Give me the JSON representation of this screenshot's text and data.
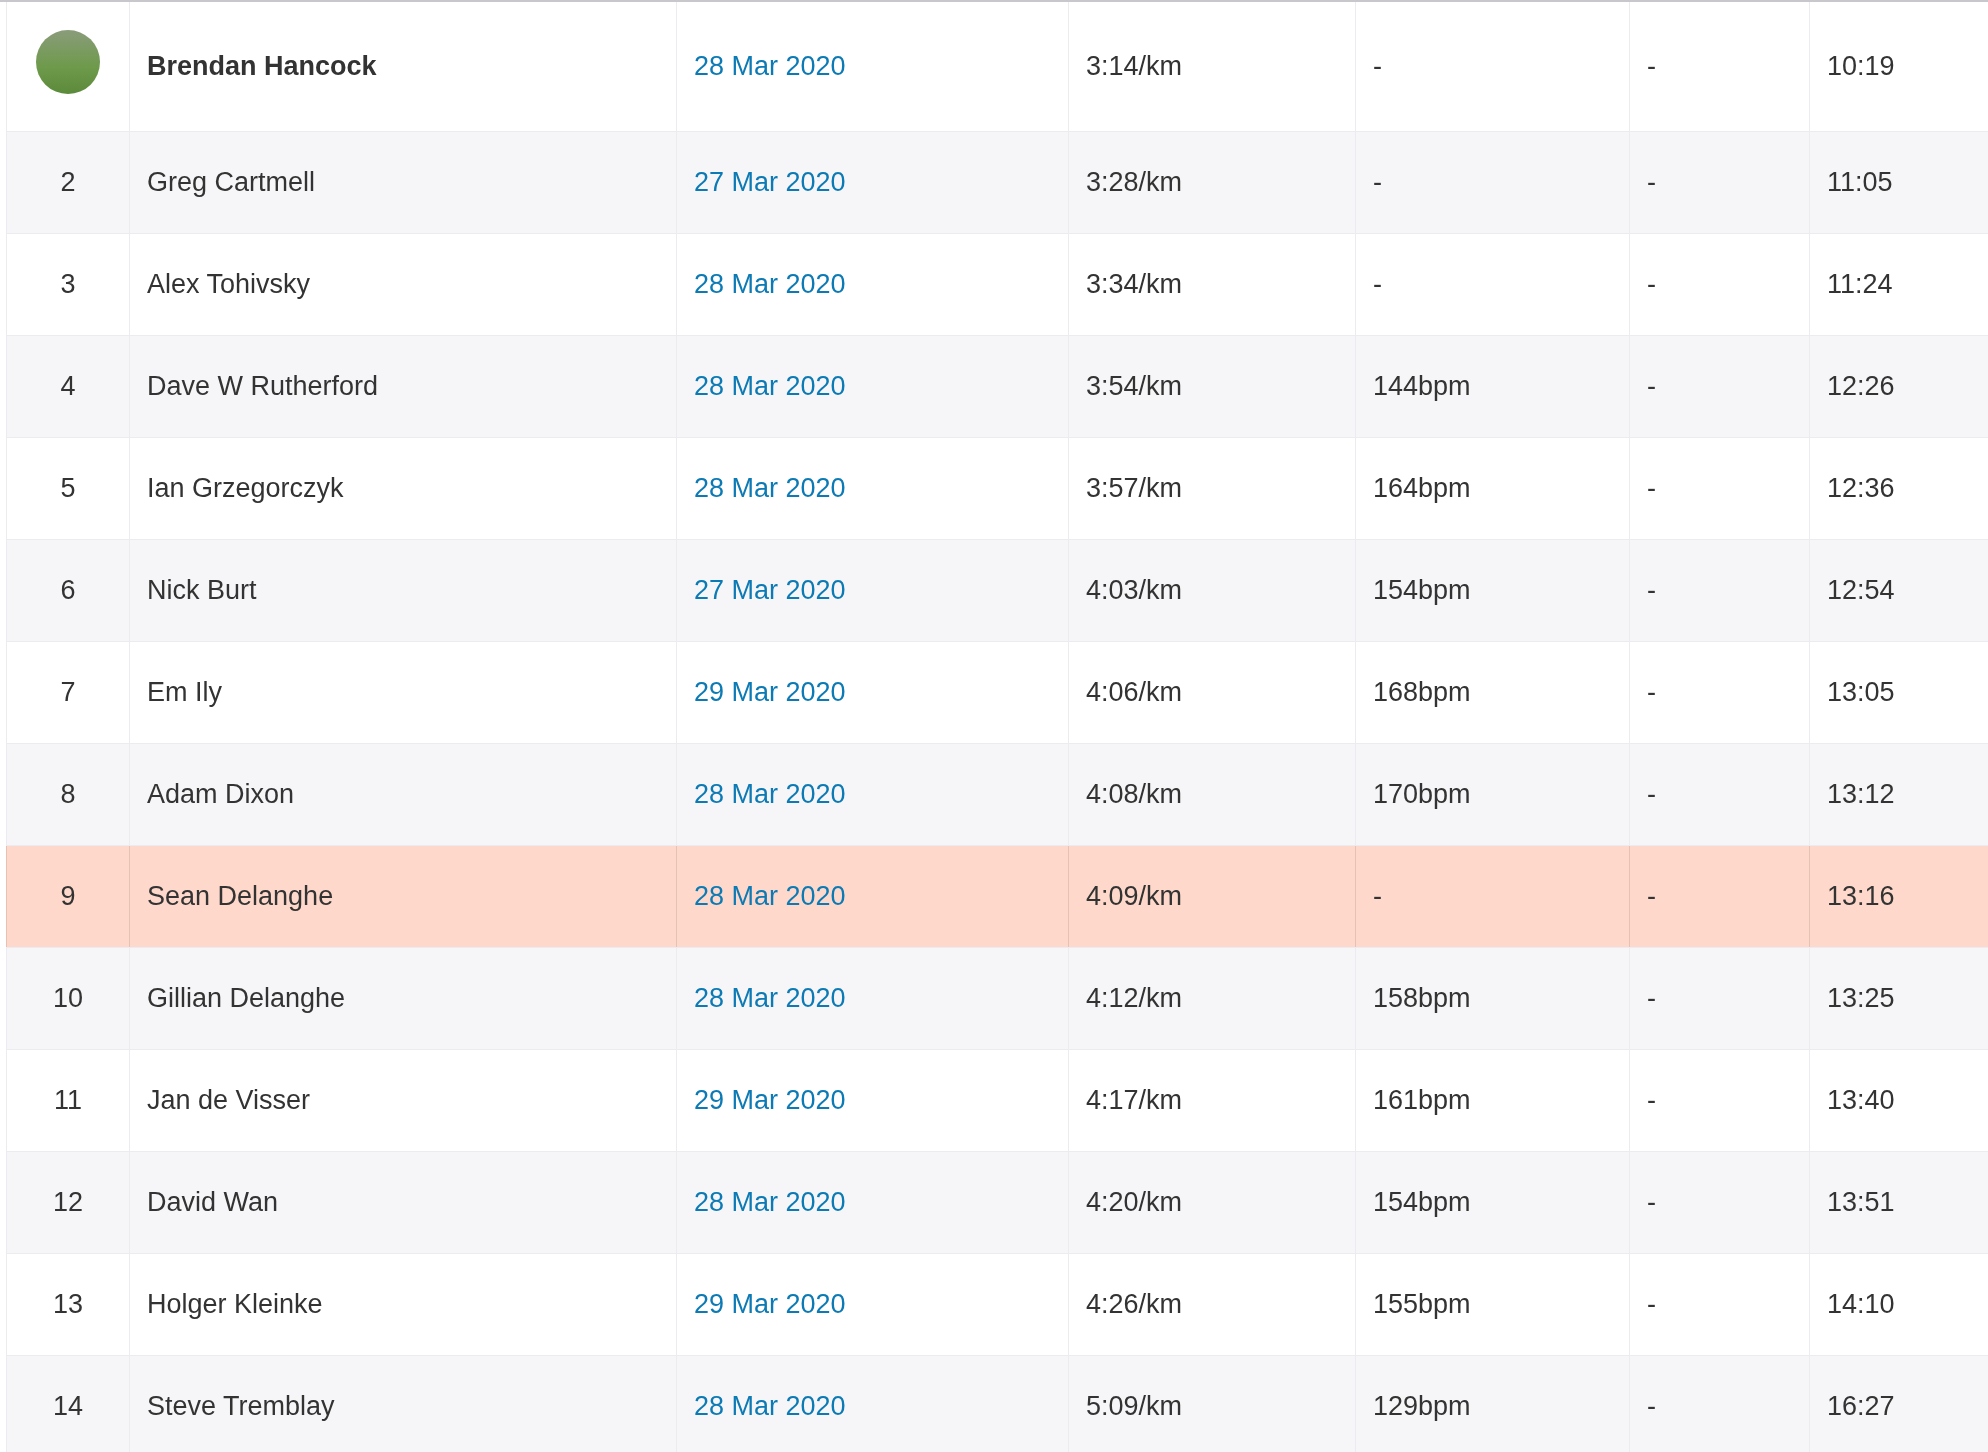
{
  "rows": [
    {
      "kind": "leader",
      "rank": "",
      "name": "Brendan Hancock",
      "date": "28 Mar 2020",
      "pace": "3:14/km",
      "heart_rate": "-",
      "column_6": "-",
      "time": "10:19",
      "highlighted": false
    },
    {
      "kind": "normal",
      "rank": "2",
      "name": "Greg Cartmell",
      "date": "27 Mar 2020",
      "pace": "3:28/km",
      "heart_rate": "-",
      "column_6": "-",
      "time": "11:05",
      "highlighted": false
    },
    {
      "kind": "normal",
      "rank": "3",
      "name": "Alex Tohivsky",
      "date": "28 Mar 2020",
      "pace": "3:34/km",
      "heart_rate": "-",
      "column_6": "-",
      "time": "11:24",
      "highlighted": false
    },
    {
      "kind": "normal",
      "rank": "4",
      "name": "Dave W Rutherford",
      "date": "28 Mar 2020",
      "pace": "3:54/km",
      "heart_rate": "144bpm",
      "column_6": "-",
      "time": "12:26",
      "highlighted": false
    },
    {
      "kind": "normal",
      "rank": "5",
      "name": "Ian Grzegorczyk",
      "date": "28 Mar 2020",
      "pace": "3:57/km",
      "heart_rate": "164bpm",
      "column_6": "-",
      "time": "12:36",
      "highlighted": false
    },
    {
      "kind": "normal",
      "rank": "6",
      "name": "Nick Burt",
      "date": "27 Mar 2020",
      "pace": "4:03/km",
      "heart_rate": "154bpm",
      "column_6": "-",
      "time": "12:54",
      "highlighted": false
    },
    {
      "kind": "normal",
      "rank": "7",
      "name": "Em Ily",
      "date": "29 Mar 2020",
      "pace": "4:06/km",
      "heart_rate": "168bpm",
      "column_6": "-",
      "time": "13:05",
      "highlighted": false
    },
    {
      "kind": "normal",
      "rank": "8",
      "name": "Adam Dixon",
      "date": "28 Mar 2020",
      "pace": "4:08/km",
      "heart_rate": "170bpm",
      "column_6": "-",
      "time": "13:12",
      "highlighted": false
    },
    {
      "kind": "normal",
      "rank": "9",
      "name": "Sean Delanghe",
      "date": "28 Mar 2020",
      "pace": "4:09/km",
      "heart_rate": "-",
      "column_6": "-",
      "time": "13:16",
      "highlighted": true
    },
    {
      "kind": "normal",
      "rank": "10",
      "name": "Gillian Delanghe",
      "date": "28 Mar 2020",
      "pace": "4:12/km",
      "heart_rate": "158bpm",
      "column_6": "-",
      "time": "13:25",
      "highlighted": false
    },
    {
      "kind": "normal",
      "rank": "11",
      "name": "Jan de Visser",
      "date": "29 Mar 2020",
      "pace": "4:17/km",
      "heart_rate": "161bpm",
      "column_6": "-",
      "time": "13:40",
      "highlighted": false
    },
    {
      "kind": "normal",
      "rank": "12",
      "name": "David Wan",
      "date": "28 Mar 2020",
      "pace": "4:20/km",
      "heart_rate": "154bpm",
      "column_6": "-",
      "time": "13:51",
      "highlighted": false
    },
    {
      "kind": "normal",
      "rank": "13",
      "name": "Holger Kleinke",
      "date": "29 Mar 2020",
      "pace": "4:26/km",
      "heart_rate": "155bpm",
      "column_6": "-",
      "time": "14:10",
      "highlighted": false
    },
    {
      "kind": "normal",
      "rank": "14",
      "name": "Steve Tremblay",
      "date": "28 Mar 2020",
      "pace": "5:09/km",
      "heart_rate": "129bpm",
      "column_6": "-",
      "time": "16:27",
      "highlighted": false
    }
  ]
}
